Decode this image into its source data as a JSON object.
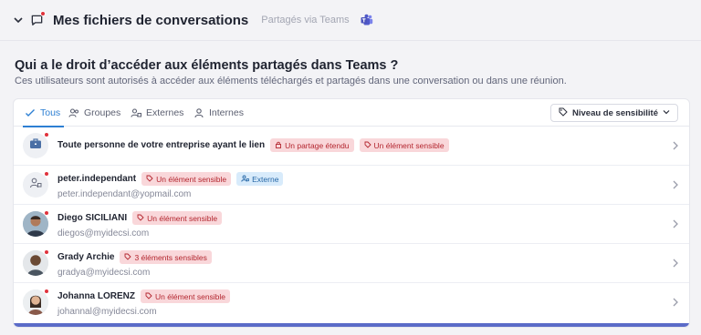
{
  "header": {
    "title": "Mes fichiers de conversations",
    "subtitle": "Partagés via Teams"
  },
  "question": "Qui a le droit d’accéder aux éléments partagés dans Teams ?",
  "description": "Ces utilisateurs sont autorisés à accéder aux éléments téléchargés et partagés dans une conversation ou dans une réunion.",
  "tabs": [
    {
      "label": "Tous",
      "active": true,
      "icon": "check-people-icon"
    },
    {
      "label": "Groupes",
      "active": false,
      "icon": "group-icon"
    },
    {
      "label": "Externes",
      "active": false,
      "icon": "external-user-icon"
    },
    {
      "label": "Internes",
      "active": false,
      "icon": "user-icon"
    }
  ],
  "sensitivity_button": "Niveau de sensibilité",
  "rows": [
    {
      "name": "Toute personne de votre entreprise ayant le lien",
      "email": "",
      "avatar": "briefcase-icon",
      "badges": [
        {
          "text": "Un partage étendu",
          "color": "red",
          "icon": "lock-icon"
        },
        {
          "text": "Un élément sensible",
          "color": "red",
          "icon": "tag-icon"
        }
      ]
    },
    {
      "name": "peter.independant",
      "email": "peter.independant@yopmail.com",
      "avatar": "external-user-icon",
      "badges": [
        {
          "text": "Un élément sensible",
          "color": "red",
          "icon": "tag-icon"
        },
        {
          "text": "Externe",
          "color": "blue",
          "icon": "external-user-icon"
        }
      ]
    },
    {
      "name": "Diego SICILIANI",
      "email": "diegos@myidecsi.com",
      "avatar": "photo",
      "badges": [
        {
          "text": "Un élément sensible",
          "color": "red",
          "icon": "tag-icon"
        }
      ]
    },
    {
      "name": "Grady Archie",
      "email": "gradya@myidecsi.com",
      "avatar": "photo",
      "badges": [
        {
          "text": "3 éléments sensibles",
          "color": "red",
          "icon": "tag-icon"
        }
      ]
    },
    {
      "name": "Johanna LORENZ",
      "email": "johannal@myidecsi.com",
      "avatar": "photo",
      "badges": [
        {
          "text": "Un élément sensible",
          "color": "red",
          "icon": "tag-icon"
        }
      ]
    }
  ],
  "colors": {
    "accent": "#2d7fd3",
    "badge_red_bg": "#f9d7da",
    "badge_red_text": "#b3262f",
    "badge_blue_bg": "#d8ebfb",
    "notification": "#e0323c",
    "panel_bottom": "#5b6bc8"
  }
}
